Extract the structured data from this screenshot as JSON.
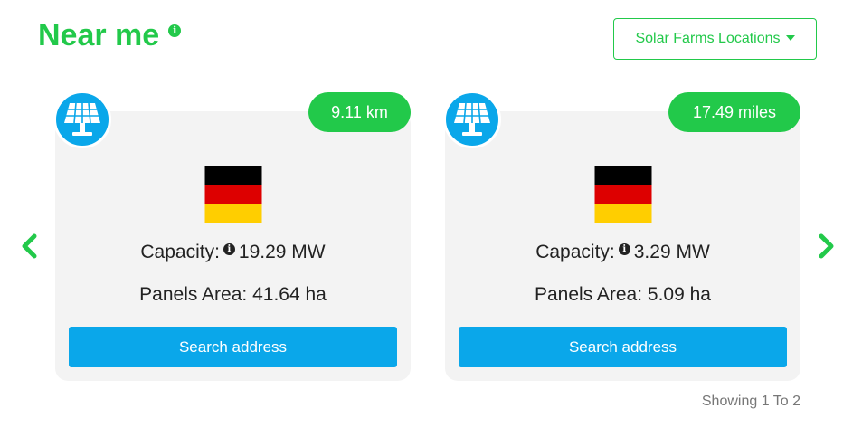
{
  "header": {
    "title": "Near me",
    "info_icon": "info-icon"
  },
  "dropdown": {
    "label": "Solar Farms Locations"
  },
  "colors": {
    "accent_green": "#22c94a",
    "accent_blue": "#0aa7ea",
    "card_bg": "#f3f3f3"
  },
  "cards": [
    {
      "icon": "solar-panel-icon",
      "distance": "9.11 km",
      "flag": "germany-flag",
      "capacity_label": "Capacity:",
      "capacity_value": "19.29 MW",
      "area_label": "Panels Area:",
      "area_value": "41.64 ha",
      "button_label": "Search address"
    },
    {
      "icon": "solar-panel-icon",
      "distance": "17.49 miles",
      "flag": "germany-flag",
      "capacity_label": "Capacity:",
      "capacity_value": "3.29 MW",
      "area_label": "Panels Area:",
      "area_value": "5.09 ha",
      "button_label": "Search address"
    }
  ],
  "pagination": {
    "text": "Showing 1 To 2"
  }
}
